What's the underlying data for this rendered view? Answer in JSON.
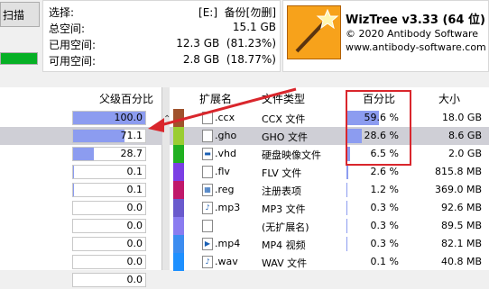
{
  "toolbar": {
    "scan_label": "扫描"
  },
  "drive_info": {
    "rows": [
      {
        "label": "选择:",
        "value": "[E:]  备份[勿删]"
      },
      {
        "label": "总空间:",
        "value": "15.1 GB"
      },
      {
        "label": "已用空间:",
        "value": "12.3 GB  (81.23%)"
      },
      {
        "label": "可用空间:",
        "value": "2.8 GB  (18.77%)"
      }
    ]
  },
  "about": {
    "title": "WizTree v3.33 (64 位)",
    "copyright": "© 2020 Antibody Software",
    "url": "www.antibody-software.com"
  },
  "left_pane": {
    "header": "父级百分比",
    "rows": [
      {
        "value": "100.0",
        "fill": 1.0
      },
      {
        "value": "71.1",
        "fill": 0.711
      },
      {
        "value": "28.7",
        "fill": 0.287
      },
      {
        "value": "0.1",
        "fill": 0.001
      },
      {
        "value": "0.1",
        "fill": 0.001
      },
      {
        "value": "0.0",
        "fill": 0.0
      },
      {
        "value": "0.0",
        "fill": 0.0
      },
      {
        "value": "0.0",
        "fill": 0.0
      },
      {
        "value": "0.0",
        "fill": 0.0
      },
      {
        "value": "0.0",
        "fill": 0.0
      }
    ]
  },
  "right_pane": {
    "headers": {
      "ext": "扩展名",
      "type": "文件类型",
      "pct": "百分比",
      "size": "大小"
    },
    "rows": [
      {
        "ext": ".ccx",
        "type": "CCX 文件",
        "pct": "59.6 %",
        "pct_val": 59.6,
        "size": "18.0 GB",
        "color": "#a0522d"
      },
      {
        "ext": ".gho",
        "type": "GHO 文件",
        "pct": "28.6 %",
        "pct_val": 28.6,
        "size": "8.6 GB",
        "color": "#9acd32"
      },
      {
        "ext": ".vhd",
        "type": "硬盘映像文件",
        "pct": "6.5 %",
        "pct_val": 6.5,
        "size": "2.0 GB",
        "color": "#20b020"
      },
      {
        "ext": ".flv",
        "type": "FLV 文件",
        "pct": "2.6 %",
        "pct_val": 2.6,
        "size": "815.8 MB",
        "color": "#7b3fe4"
      },
      {
        "ext": ".reg",
        "type": "注册表项",
        "pct": "1.2 %",
        "pct_val": 1.2,
        "size": "369.0 MB",
        "color": "#c0186a"
      },
      {
        "ext": ".mp3",
        "type": "MP3 文件",
        "pct": "0.3 %",
        "pct_val": 0.3,
        "size": "92.6 MB",
        "color": "#6a5acd"
      },
      {
        "ext": "",
        "type": "(无扩展名)",
        "pct": "0.3 %",
        "pct_val": 0.3,
        "size": "89.5 MB",
        "color": "#8a7cf0"
      },
      {
        "ext": ".mp4",
        "type": "MP4 视频",
        "pct": "0.3 %",
        "pct_val": 0.3,
        "size": "82.1 MB",
        "color": "#3c8cf0"
      },
      {
        "ext": ".wav",
        "type": "WAV 文件",
        "pct": "0.1 %",
        "pct_val": 0.1,
        "size": "40.8 MB",
        "color": "#1e90ff"
      }
    ]
  },
  "colors": {
    "accent_box": "#d9262c",
    "bar_fill": "#8c9cf0",
    "selection": "#cfcfd6"
  }
}
